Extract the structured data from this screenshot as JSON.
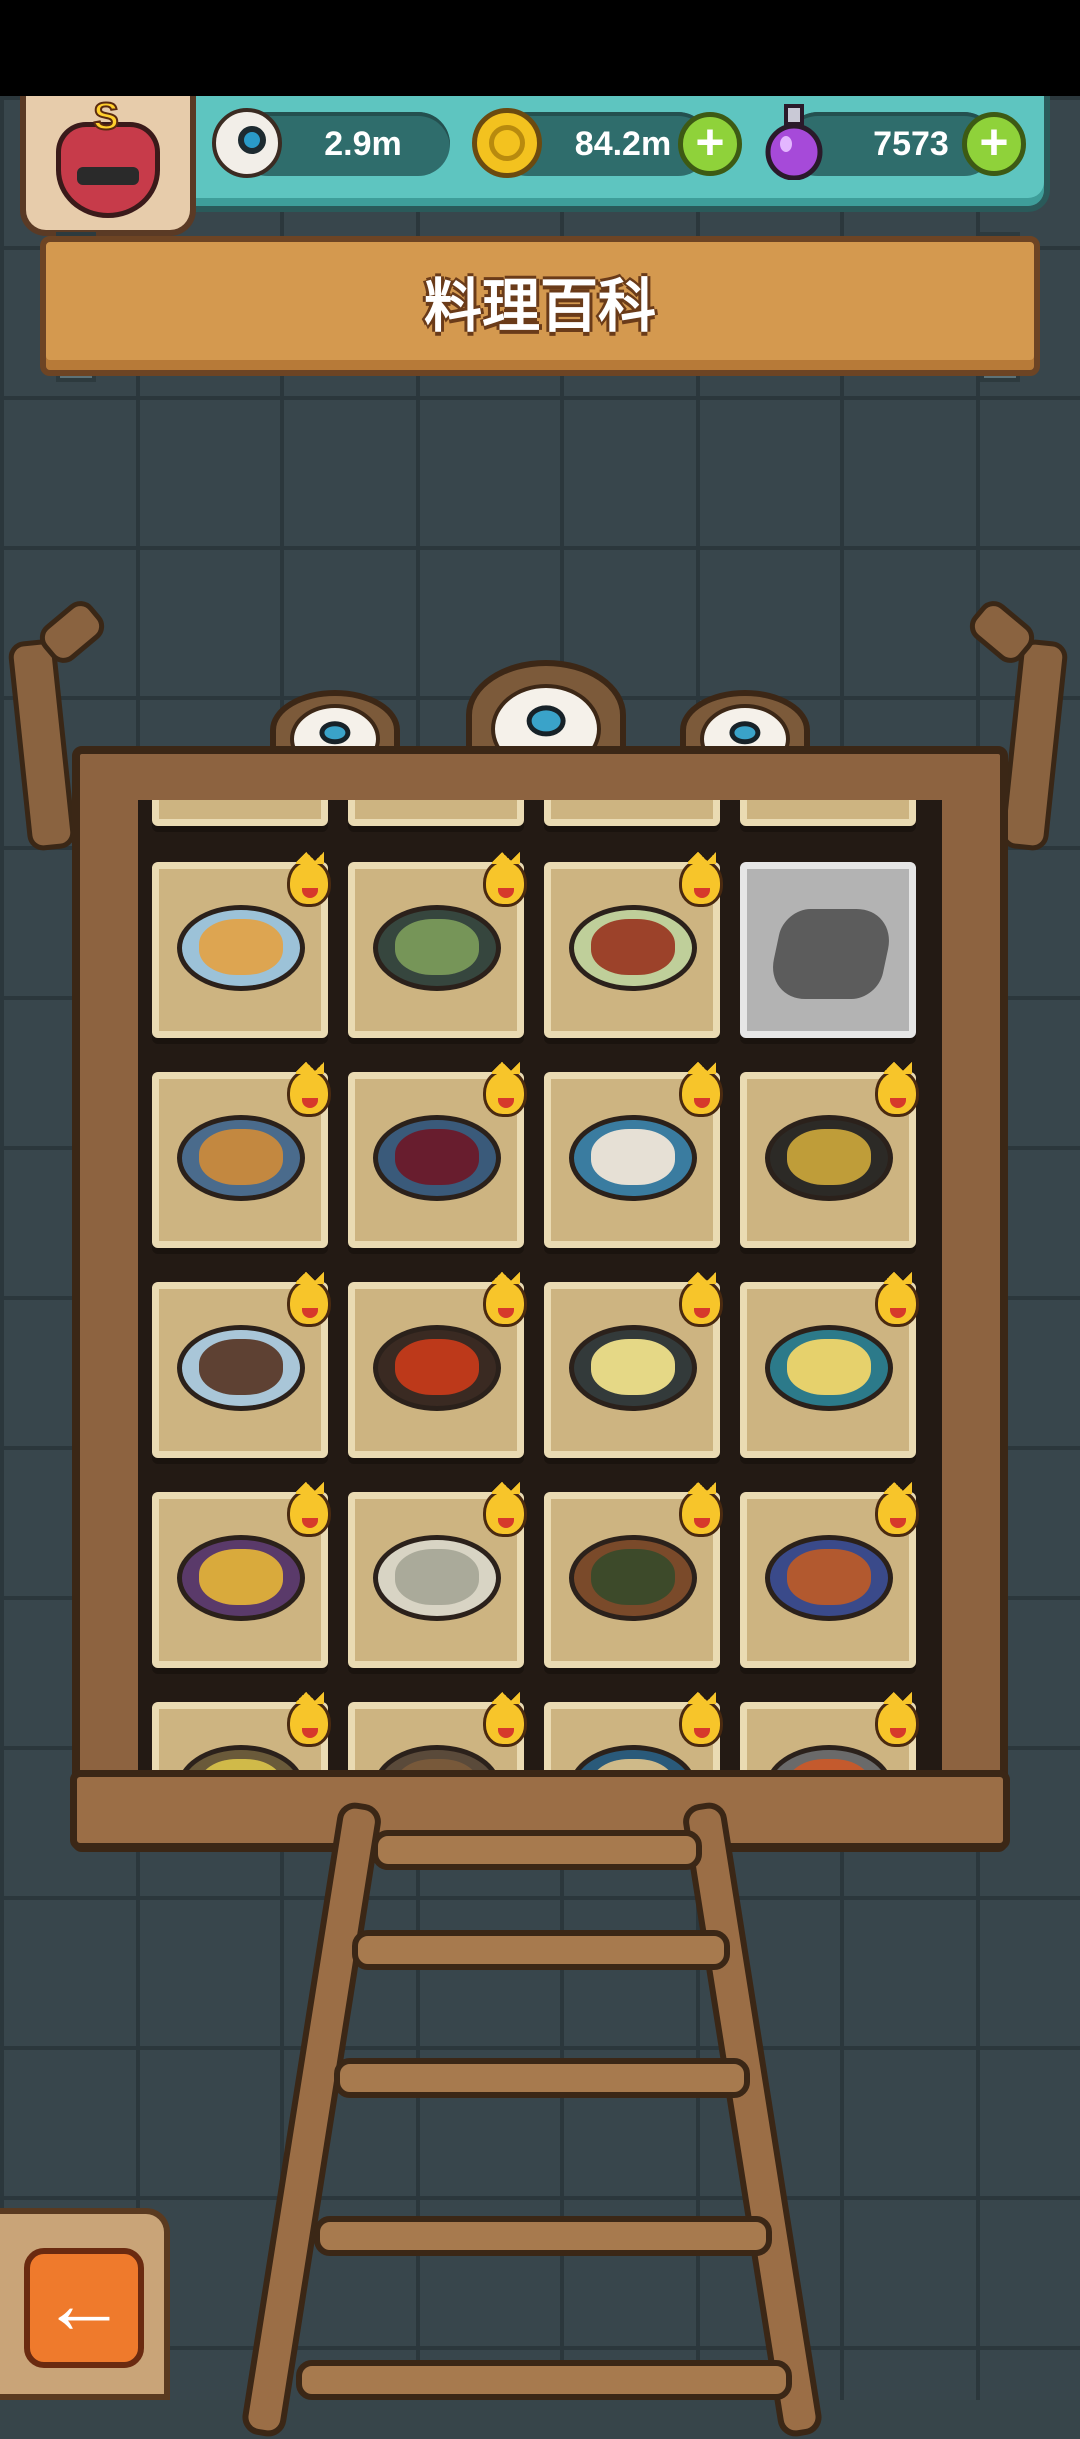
{
  "header": {
    "eyeballs": "2.9m",
    "coins": "84.2m",
    "potions": "7573",
    "rank": "S"
  },
  "title": "料理百科",
  "icons": {
    "eyeball": "eyeball-icon",
    "coin": "coin-icon",
    "potion": "potion-icon",
    "plus": "plus-icon",
    "back": "back-arrow-icon",
    "crown": "crown-badge-icon"
  },
  "grid": {
    "rows": [
      [
        {
          "name": "dish-1",
          "locked": false,
          "plate": "#9cc2d8",
          "food": "#e0a34a"
        },
        {
          "name": "dish-2",
          "locked": false,
          "plate": "#36463e",
          "food": "#7a9a5a"
        },
        {
          "name": "dish-3",
          "locked": false,
          "plate": "#bfcf9a",
          "food": "#9a3a24"
        },
        {
          "name": "dish-4",
          "locked": true,
          "plate": "",
          "food": ""
        }
      ],
      [
        {
          "name": "dish-5",
          "locked": false,
          "plate": "#4a6b8c",
          "food": "#c98a3c"
        },
        {
          "name": "dish-6",
          "locked": false,
          "plate": "#3a5a7a",
          "food": "#6a1a2a"
        },
        {
          "name": "dish-7",
          "locked": false,
          "plate": "#3a7ca0",
          "food": "#efe6d8"
        },
        {
          "name": "dish-8",
          "locked": false,
          "plate": "#2c2a26",
          "food": "#c7a33a"
        }
      ],
      [
        {
          "name": "dish-9",
          "locked": false,
          "plate": "#a9c6d8",
          "food": "#5a3a2a"
        },
        {
          "name": "dish-10",
          "locked": false,
          "plate": "#3a2a22",
          "food": "#c43a1a"
        },
        {
          "name": "dish-11",
          "locked": false,
          "plate": "#333a3a",
          "food": "#efe08a"
        },
        {
          "name": "dish-12",
          "locked": false,
          "plate": "#2c7a8a",
          "food": "#f0d66a"
        }
      ],
      [
        {
          "name": "dish-13",
          "locked": false,
          "plate": "#5a3a6a",
          "food": "#e0b03a"
        },
        {
          "name": "dish-14",
          "locked": false,
          "plate": "#d8d4c4",
          "food": "#a8a898"
        },
        {
          "name": "dish-15",
          "locked": false,
          "plate": "#7a4a2a",
          "food": "#3a4a2a"
        },
        {
          "name": "dish-16",
          "locked": false,
          "plate": "#3a4a8a",
          "food": "#b85a2a"
        }
      ],
      [
        {
          "name": "dish-17",
          "locked": false,
          "plate": "#6a5a3a",
          "food": "#d6c04a"
        },
        {
          "name": "dish-18",
          "locked": false,
          "plate": "#5a4a3a",
          "food": "#7a5a3a"
        },
        {
          "name": "dish-19",
          "locked": false,
          "plate": "#2a5a7a",
          "food": "#d8c08a"
        },
        {
          "name": "dish-20",
          "locked": false,
          "plate": "#6a6a6a",
          "food": "#c95a2a"
        }
      ]
    ]
  }
}
